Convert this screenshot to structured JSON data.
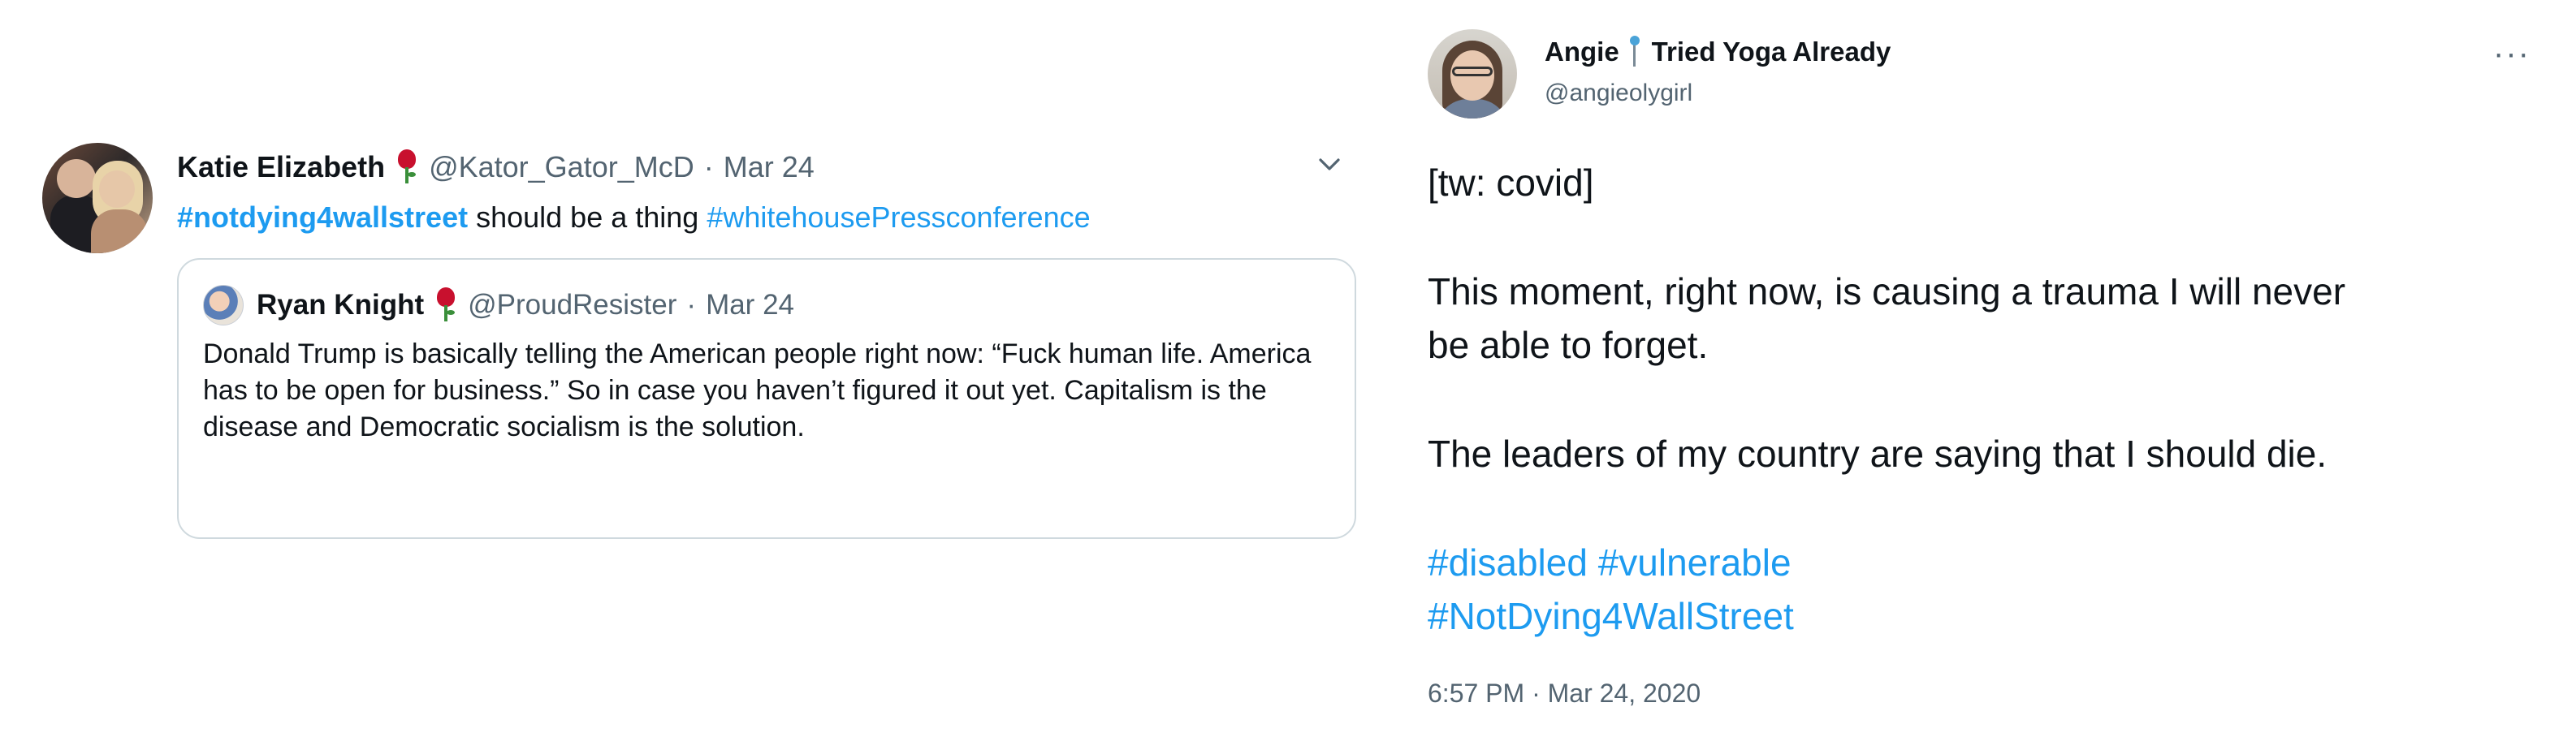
{
  "left_tweet": {
    "author_name": "Katie Elizabeth",
    "author_handle": "@Kator_Gator_McD",
    "separator": "·",
    "date": "Mar 24",
    "text_hashtag1": "#notdying4wallstreet",
    "text_middle": " should be a thing ",
    "text_hashtag2": "#whitehousePressconference",
    "quote": {
      "author_name": "Ryan Knight",
      "author_handle": "@ProudResister",
      "separator": "·",
      "date": "Mar 24",
      "body": "Donald Trump is basically telling the American people right now: “Fuck human life. America has to be open for business.” So in case you haven’t figured it out yet. Capitalism is the disease and Democratic socialism is the solution."
    }
  },
  "right_tweet": {
    "author_name_part1": "Angie",
    "author_name_part2": "Tried Yoga Already",
    "author_handle": "@angieolygirl",
    "more_label": "···",
    "line1": "[tw: covid]",
    "line2": "This moment, right now, is causing a trauma I will never",
    "line3": "be able to forget.",
    "line4": "The leaders of my country are saying that I should die.",
    "tags_line1": "#disabled #vulnerable",
    "tags_line2": "#NotDying4WallStreet",
    "timestamp": "6:57 PM · Mar 24, 2020"
  },
  "colors": {
    "link": "#1d9bf0",
    "muted": "#536471",
    "text": "#0f1419",
    "border": "#cfd9de",
    "rose": "#c8102e"
  },
  "icons": [
    "rose-emoji-icon",
    "chevron-down-icon",
    "pushpin-emoji-icon",
    "more-icon"
  ]
}
